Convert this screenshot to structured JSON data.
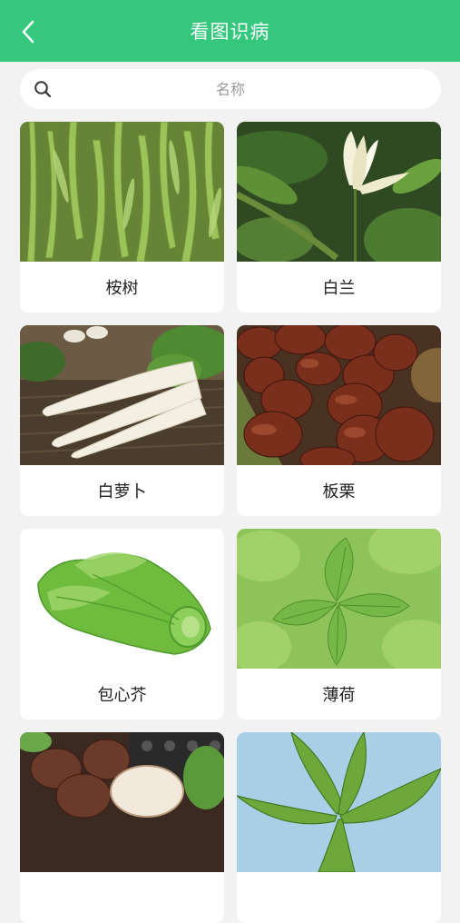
{
  "header": {
    "title": "看图识病"
  },
  "search": {
    "placeholder": "名称"
  },
  "plants": [
    {
      "name": "桉树"
    },
    {
      "name": "白兰"
    },
    {
      "name": "白萝卜"
    },
    {
      "name": "板栗"
    },
    {
      "name": "包心芥"
    },
    {
      "name": "薄荷"
    },
    {
      "name": ""
    },
    {
      "name": ""
    }
  ],
  "colors": {
    "accent": "#35c87d",
    "background": "#f2f2f2"
  }
}
